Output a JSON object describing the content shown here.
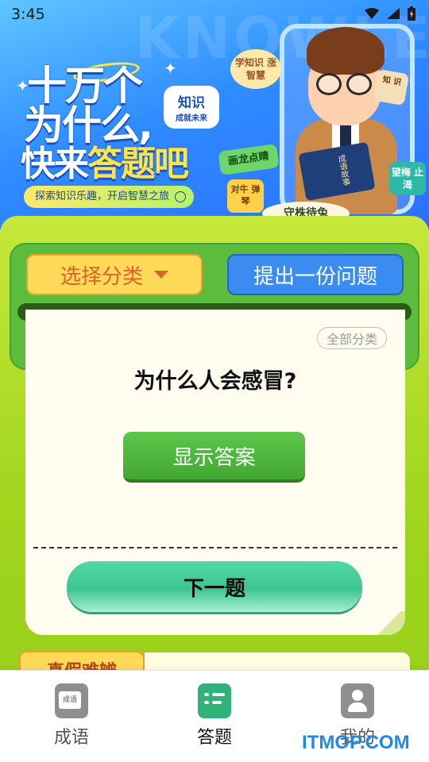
{
  "status_bar": {
    "time": "3:45"
  },
  "banner": {
    "title_line1": "十万个",
    "title_line2": "为什么,",
    "title_line3_a": "快来",
    "title_line3_b": "答题吧",
    "knowledge_badge_main": "知识",
    "knowledge_badge_sub": "成就未来",
    "slogan": "探索知识乐趣，开启智慧之旅",
    "tag_learn": "学知识 涨智慧",
    "tag_dragon": "画龙点睛",
    "tag_cow": "对牛 弹琴",
    "tag_plum": "望梅 止渴",
    "tag_book": "知 识",
    "tag_rabbit": "守株待兔",
    "book_cover": "成语故事"
  },
  "actions": {
    "select_category": "选择分类",
    "ask_question": "提出一份问题"
  },
  "card": {
    "category_tag": "全部分类",
    "question": "为什么人会感冒?",
    "show_answer": "显示答案",
    "next_question": "下一题"
  },
  "section": {
    "tab_label": "真假难辨"
  },
  "nav": {
    "items": [
      {
        "label": "成语",
        "icon": "idiom-book-icon",
        "active": false
      },
      {
        "label": "答题",
        "icon": "quiz-icon",
        "active": true
      },
      {
        "label": "我的",
        "icon": "profile-icon",
        "active": false
      }
    ]
  },
  "watermark": "ITMOP.COM",
  "colors": {
    "banner_blue": "#2f8cff",
    "panel_green": "#a2d61f",
    "category_yellow": "#ffd957",
    "ask_blue": "#3b8cf0",
    "show_green": "#4db63a",
    "next_teal": "#3ec493"
  }
}
